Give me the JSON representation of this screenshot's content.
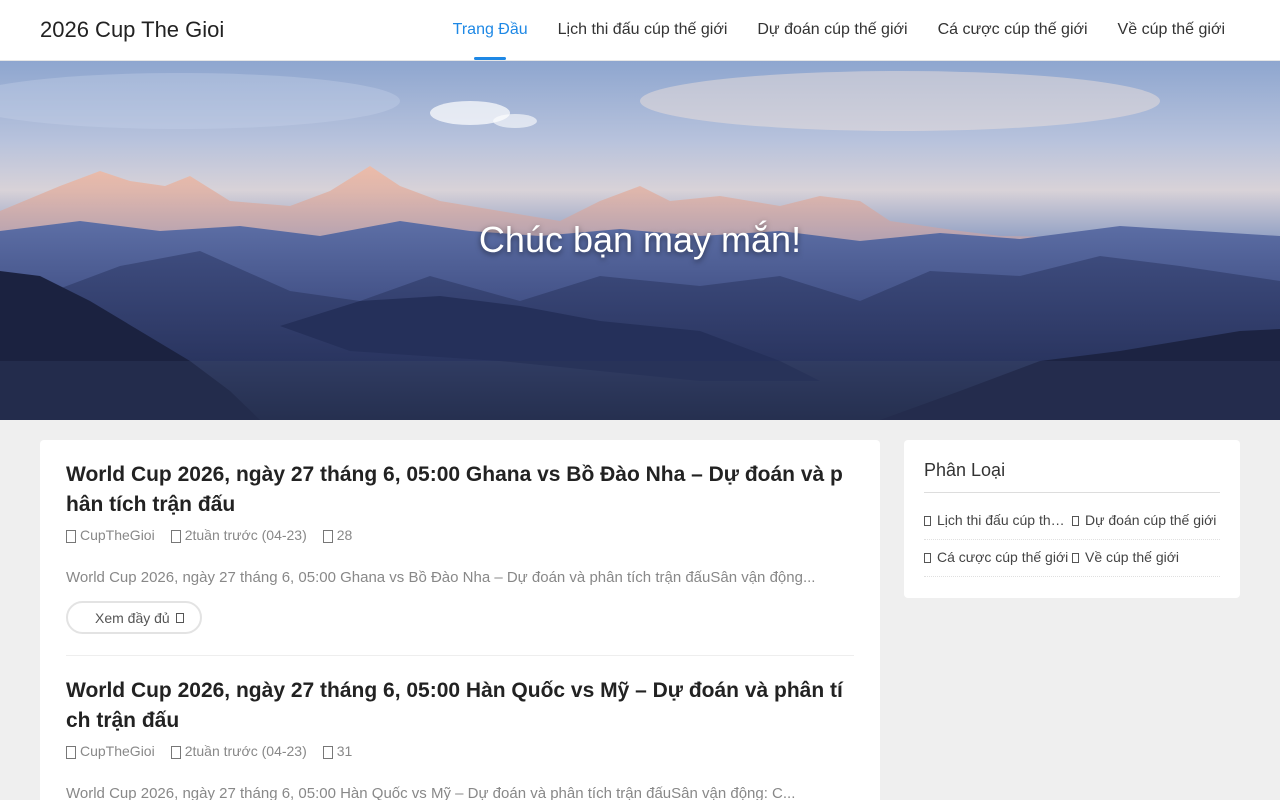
{
  "header": {
    "logo": "2026 Cup The Gioi",
    "nav": [
      {
        "label": "Trang Đầu",
        "active": true
      },
      {
        "label": "Lịch thi đấu cúp thế giới",
        "active": false
      },
      {
        "label": "Dự đoán cúp thế giới",
        "active": false
      },
      {
        "label": "Cá cược cúp thế giới",
        "active": false
      },
      {
        "label": "Về cúp thế giới",
        "active": false
      }
    ]
  },
  "hero": {
    "title": "Chúc bạn may mắn!"
  },
  "posts": [
    {
      "title": "World Cup 2026, ngày 27 tháng 6, 05:00 Ghana vs Bồ Đào Nha – Dự đoán và phân tích trận đấu",
      "author": "CupTheGioi",
      "date": "2tuần trước (04-23)",
      "views": "28",
      "excerpt": "World Cup 2026, ngày 27 tháng 6, 05:00 Ghana vs Bồ Đào Nha – Dự đoán và phân tích trận đấuSân vận động...",
      "read_more": "Xem đầy đủ"
    },
    {
      "title": "World Cup 2026, ngày 27 tháng 6, 05:00 Hàn Quốc vs Mỹ – Dự đoán và phân tích trận đấu",
      "author": "CupTheGioi",
      "date": "2tuần trước (04-23)",
      "views": "31",
      "excerpt": "World Cup 2026, ngày 27 tháng 6, 05:00 Hàn Quốc vs Mỹ – Dự đoán và phân tích trận đấuSân vận động: C..."
    }
  ],
  "sidebar": {
    "title": "Phân Loại",
    "categories": [
      "Lịch thi đấu cúp thế giới",
      "Dự đoán cúp thế giới",
      "Cá cược cúp thế giới",
      "Về cúp thế giới"
    ]
  },
  "colors": {
    "accent": "#1e88e5",
    "background": "#efefef"
  }
}
